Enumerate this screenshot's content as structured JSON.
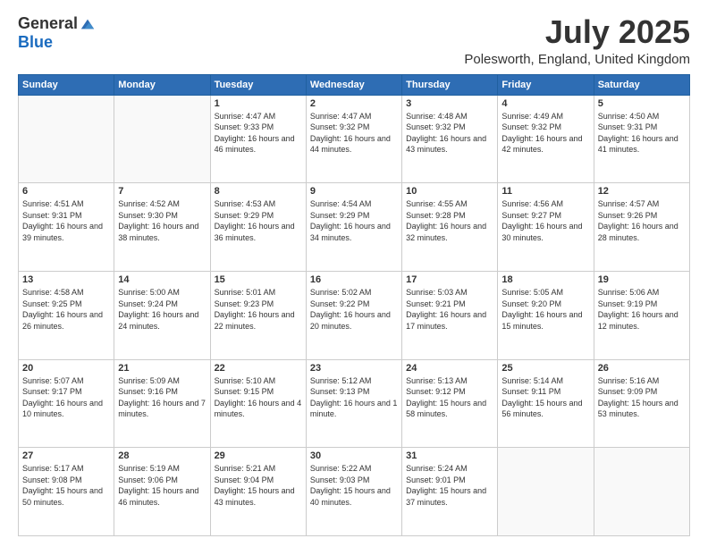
{
  "header": {
    "logo_general": "General",
    "logo_blue": "Blue",
    "month_title": "July 2025",
    "location": "Polesworth, England, United Kingdom"
  },
  "weekdays": [
    "Sunday",
    "Monday",
    "Tuesday",
    "Wednesday",
    "Thursday",
    "Friday",
    "Saturday"
  ],
  "weeks": [
    [
      {
        "day": "",
        "info": ""
      },
      {
        "day": "",
        "info": ""
      },
      {
        "day": "1",
        "info": "Sunrise: 4:47 AM\nSunset: 9:33 PM\nDaylight: 16 hours and 46 minutes."
      },
      {
        "day": "2",
        "info": "Sunrise: 4:47 AM\nSunset: 9:32 PM\nDaylight: 16 hours and 44 minutes."
      },
      {
        "day": "3",
        "info": "Sunrise: 4:48 AM\nSunset: 9:32 PM\nDaylight: 16 hours and 43 minutes."
      },
      {
        "day": "4",
        "info": "Sunrise: 4:49 AM\nSunset: 9:32 PM\nDaylight: 16 hours and 42 minutes."
      },
      {
        "day": "5",
        "info": "Sunrise: 4:50 AM\nSunset: 9:31 PM\nDaylight: 16 hours and 41 minutes."
      }
    ],
    [
      {
        "day": "6",
        "info": "Sunrise: 4:51 AM\nSunset: 9:31 PM\nDaylight: 16 hours and 39 minutes."
      },
      {
        "day": "7",
        "info": "Sunrise: 4:52 AM\nSunset: 9:30 PM\nDaylight: 16 hours and 38 minutes."
      },
      {
        "day": "8",
        "info": "Sunrise: 4:53 AM\nSunset: 9:29 PM\nDaylight: 16 hours and 36 minutes."
      },
      {
        "day": "9",
        "info": "Sunrise: 4:54 AM\nSunset: 9:29 PM\nDaylight: 16 hours and 34 minutes."
      },
      {
        "day": "10",
        "info": "Sunrise: 4:55 AM\nSunset: 9:28 PM\nDaylight: 16 hours and 32 minutes."
      },
      {
        "day": "11",
        "info": "Sunrise: 4:56 AM\nSunset: 9:27 PM\nDaylight: 16 hours and 30 minutes."
      },
      {
        "day": "12",
        "info": "Sunrise: 4:57 AM\nSunset: 9:26 PM\nDaylight: 16 hours and 28 minutes."
      }
    ],
    [
      {
        "day": "13",
        "info": "Sunrise: 4:58 AM\nSunset: 9:25 PM\nDaylight: 16 hours and 26 minutes."
      },
      {
        "day": "14",
        "info": "Sunrise: 5:00 AM\nSunset: 9:24 PM\nDaylight: 16 hours and 24 minutes."
      },
      {
        "day": "15",
        "info": "Sunrise: 5:01 AM\nSunset: 9:23 PM\nDaylight: 16 hours and 22 minutes."
      },
      {
        "day": "16",
        "info": "Sunrise: 5:02 AM\nSunset: 9:22 PM\nDaylight: 16 hours and 20 minutes."
      },
      {
        "day": "17",
        "info": "Sunrise: 5:03 AM\nSunset: 9:21 PM\nDaylight: 16 hours and 17 minutes."
      },
      {
        "day": "18",
        "info": "Sunrise: 5:05 AM\nSunset: 9:20 PM\nDaylight: 16 hours and 15 minutes."
      },
      {
        "day": "19",
        "info": "Sunrise: 5:06 AM\nSunset: 9:19 PM\nDaylight: 16 hours and 12 minutes."
      }
    ],
    [
      {
        "day": "20",
        "info": "Sunrise: 5:07 AM\nSunset: 9:17 PM\nDaylight: 16 hours and 10 minutes."
      },
      {
        "day": "21",
        "info": "Sunrise: 5:09 AM\nSunset: 9:16 PM\nDaylight: 16 hours and 7 minutes."
      },
      {
        "day": "22",
        "info": "Sunrise: 5:10 AM\nSunset: 9:15 PM\nDaylight: 16 hours and 4 minutes."
      },
      {
        "day": "23",
        "info": "Sunrise: 5:12 AM\nSunset: 9:13 PM\nDaylight: 16 hours and 1 minute."
      },
      {
        "day": "24",
        "info": "Sunrise: 5:13 AM\nSunset: 9:12 PM\nDaylight: 15 hours and 58 minutes."
      },
      {
        "day": "25",
        "info": "Sunrise: 5:14 AM\nSunset: 9:11 PM\nDaylight: 15 hours and 56 minutes."
      },
      {
        "day": "26",
        "info": "Sunrise: 5:16 AM\nSunset: 9:09 PM\nDaylight: 15 hours and 53 minutes."
      }
    ],
    [
      {
        "day": "27",
        "info": "Sunrise: 5:17 AM\nSunset: 9:08 PM\nDaylight: 15 hours and 50 minutes."
      },
      {
        "day": "28",
        "info": "Sunrise: 5:19 AM\nSunset: 9:06 PM\nDaylight: 15 hours and 46 minutes."
      },
      {
        "day": "29",
        "info": "Sunrise: 5:21 AM\nSunset: 9:04 PM\nDaylight: 15 hours and 43 minutes."
      },
      {
        "day": "30",
        "info": "Sunrise: 5:22 AM\nSunset: 9:03 PM\nDaylight: 15 hours and 40 minutes."
      },
      {
        "day": "31",
        "info": "Sunrise: 5:24 AM\nSunset: 9:01 PM\nDaylight: 15 hours and 37 minutes."
      },
      {
        "day": "",
        "info": ""
      },
      {
        "day": "",
        "info": ""
      }
    ]
  ]
}
